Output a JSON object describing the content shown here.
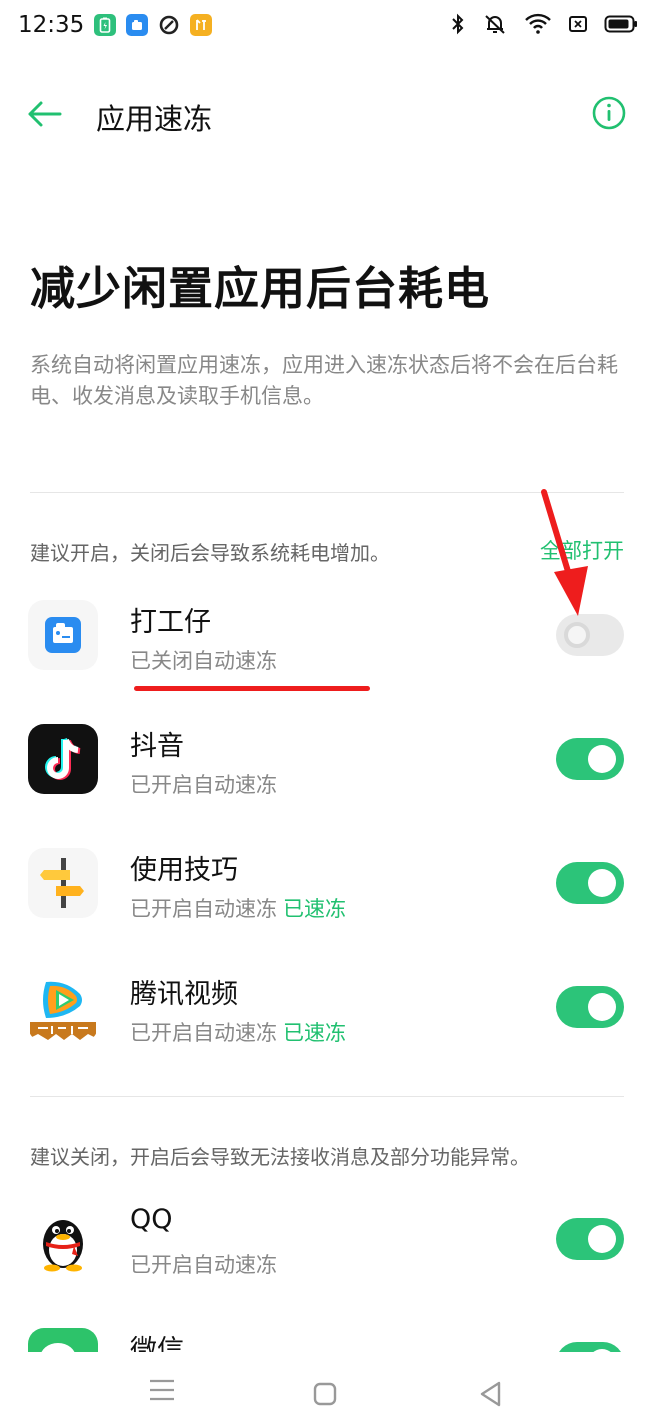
{
  "status_bar": {
    "time": "12:35",
    "left_icons": [
      "battery-saver-app-icon",
      "dagongzai-app-icon",
      "browser-app-icon",
      "tools-app-icon"
    ],
    "right_icons": [
      "bluetooth-icon",
      "mute-icon",
      "wifi-icon",
      "sim-icon",
      "battery-icon"
    ]
  },
  "header": {
    "title": "应用速冻"
  },
  "hero": {
    "title": "减少闲置应用后台耗电",
    "description": "系统自动将闲置应用速冻，应用进入速冻状态后将不会在后台耗电、收发消息及读取手机信息。"
  },
  "sections": [
    {
      "label": "建议开启，关闭后会导致系统耗电增加。",
      "action": "全部打开",
      "apps": [
        {
          "name": "打工仔",
          "status": "已关闭自动速冻",
          "frozen": "",
          "enabled": false
        },
        {
          "name": "抖音",
          "status": "已开启自动速冻",
          "frozen": "",
          "enabled": true
        },
        {
          "name": "使用技巧",
          "status": "已开启自动速冻",
          "frozen": "已速冻",
          "enabled": true
        },
        {
          "name": "腾讯视频",
          "status": "已开启自动速冻",
          "frozen": "已速冻",
          "enabled": true
        }
      ]
    },
    {
      "label": "建议关闭，开启后会导致无法接收消息及部分功能异常。",
      "apps": [
        {
          "name": "QQ",
          "status": "已开启自动速冻",
          "frozen": "",
          "enabled": true
        },
        {
          "name": "微信",
          "status": "",
          "frozen": "",
          "enabled": true
        }
      ]
    }
  ],
  "colors": {
    "accent": "#21c070",
    "toggle_on": "#2cc479",
    "annotation": "#ee1d1d"
  }
}
